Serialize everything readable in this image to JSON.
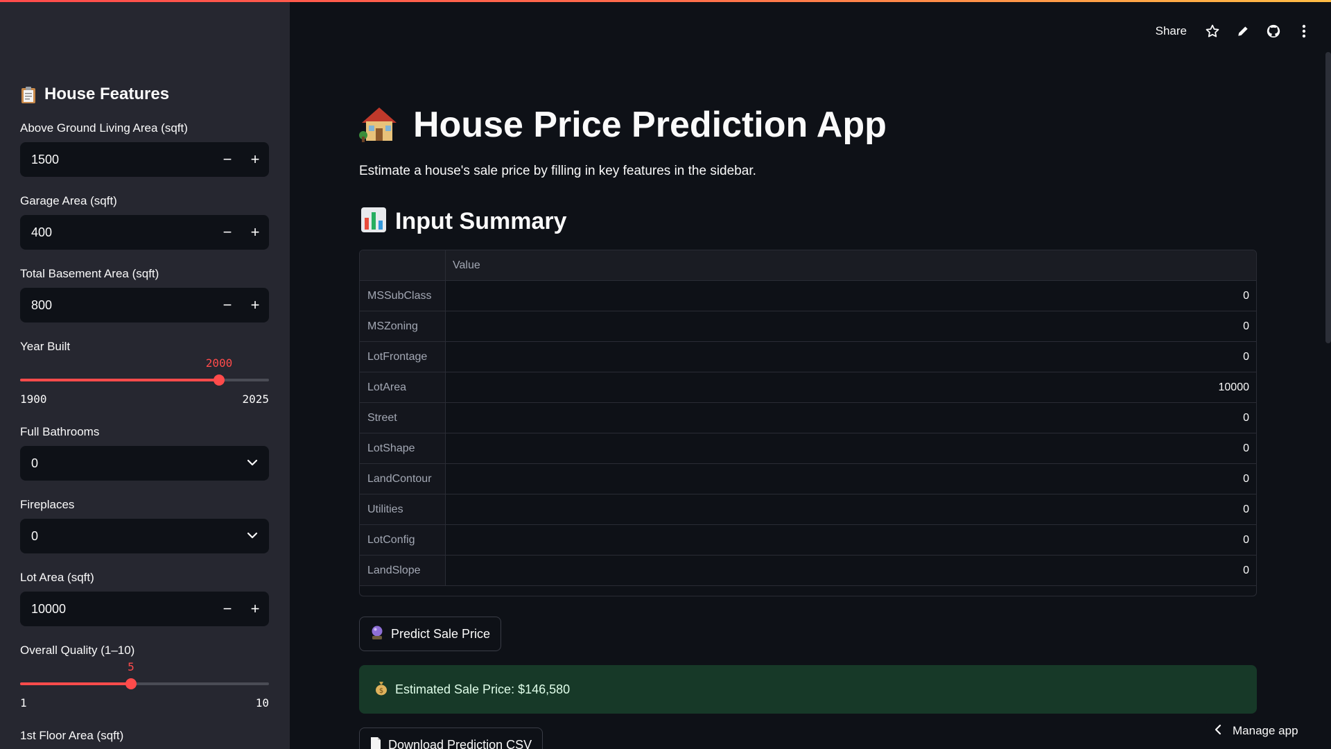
{
  "header": {
    "share_label": "Share",
    "icons": [
      "star-icon",
      "pencil-icon",
      "github-icon",
      "more-vert-icon"
    ]
  },
  "sidebar": {
    "title": "House Features",
    "title_icon": "clipboard-icon",
    "gr_liv_area": {
      "label": "Above Ground Living Area (sqft)",
      "value": "1500"
    },
    "garage_area": {
      "label": "Garage Area (sqft)",
      "value": "400"
    },
    "basement_area": {
      "label": "Total Basement Area (sqft)",
      "value": "800"
    },
    "year_built": {
      "label": "Year Built",
      "value": "2000",
      "min": "1900",
      "max": "2025",
      "fraction": 0.8
    },
    "full_bath": {
      "label": "Full Bathrooms",
      "value": "0"
    },
    "fireplaces": {
      "label": "Fireplaces",
      "value": "0"
    },
    "lot_area": {
      "label": "Lot Area (sqft)",
      "value": "10000"
    },
    "overall_qual": {
      "label": "Overall Quality (1–10)",
      "value": "5",
      "min": "1",
      "max": "10",
      "fraction": 0.4444
    },
    "first_floor": {
      "label": "1st Floor Area (sqft)"
    }
  },
  "main": {
    "title": "House Price Prediction App",
    "title_icon": "house-icon",
    "subtitle": "Estimate a house's sale price by filling in key features in the sidebar.",
    "summary_title": "Input Summary",
    "summary_icon": "bar-chart-icon",
    "table": {
      "header": "Value",
      "rows": [
        {
          "name": "MSSubClass",
          "value": "0"
        },
        {
          "name": "MSZoning",
          "value": "0"
        },
        {
          "name": "LotFrontage",
          "value": "0"
        },
        {
          "name": "LotArea",
          "value": "10000"
        },
        {
          "name": "Street",
          "value": "0"
        },
        {
          "name": "LotShape",
          "value": "0"
        },
        {
          "name": "LandContour",
          "value": "0"
        },
        {
          "name": "Utilities",
          "value": "0"
        },
        {
          "name": "LotConfig",
          "value": "0"
        },
        {
          "name": "LandSlope",
          "value": "0"
        }
      ]
    },
    "predict_button": "Predict Sale Price",
    "result": "Estimated Sale Price: $146,580",
    "download_button": "Download Prediction CSV"
  },
  "footer": {
    "manage_label": "Manage app"
  },
  "colors": {
    "accent": "#ff4b4b",
    "success_bg": "#173928",
    "sidebar_bg": "#262730",
    "app_bg": "#0e1117"
  }
}
